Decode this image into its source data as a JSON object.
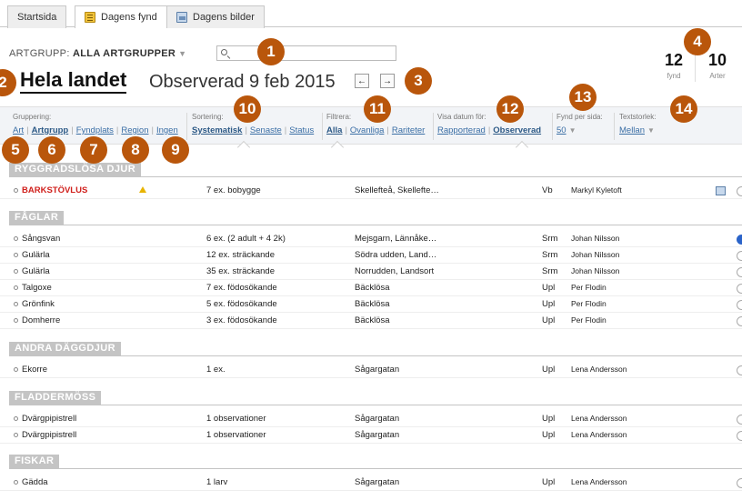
{
  "tabs": [
    {
      "label": "Startsida"
    },
    {
      "label": "Dagens fynd"
    },
    {
      "label": "Dagens bilder"
    }
  ],
  "header": {
    "artgrupp_prefix": "ARTGRUPP:",
    "artgrupp_value": "ALLA ARTGRUPPER",
    "title": "Hela landet",
    "subtitle": "Observerad 9 feb 2015",
    "prev_icon": "arrow-left-icon",
    "next_icon": "arrow-right-icon",
    "stats": [
      {
        "value": "12",
        "label": "fynd"
      },
      {
        "value": "10",
        "label": "Arter"
      }
    ]
  },
  "search": {
    "value": "",
    "placeholder": ""
  },
  "filters": {
    "gruppering": {
      "label": "Gruppering:",
      "options": [
        "Art",
        "Artgrupp",
        "Fyndplats",
        "Region",
        "Ingen"
      ],
      "selected": "Artgrupp"
    },
    "sortering": {
      "label": "Sortering:",
      "options": [
        "Systematisk",
        "Senaste",
        "Status"
      ],
      "selected": "Systematisk"
    },
    "filtrera": {
      "label": "Filtrera:",
      "options": [
        "Alla",
        "Ovanliga",
        "Rariteter"
      ],
      "selected": "Alla"
    },
    "visa_datum": {
      "label": "Visa datum för:",
      "options": [
        "Rapporterad",
        "Observerad"
      ],
      "selected": "Observerad"
    },
    "fynd_per_sida": {
      "label": "Fynd per sida:",
      "value": "50"
    },
    "textstorlek": {
      "label": "Textstorlek:",
      "value": "Mellan"
    }
  },
  "badges": [
    "1",
    "2",
    "3",
    "4",
    "5",
    "6",
    "7",
    "8",
    "9",
    "10",
    "11",
    "12",
    "13",
    "14"
  ],
  "sections": [
    {
      "title": "RYGGRADSLÖSA DJUR",
      "rows": [
        {
          "species": "BARKSTÖVLUS",
          "rare": true,
          "count": "7 ex. bobygge",
          "place": "Skellefteå, Skellefte…",
          "region": "Vb",
          "observer": "Markyl Kyletoft",
          "has_image": true,
          "status": "empty"
        }
      ]
    },
    {
      "title": "FÅGLAR",
      "rows": [
        {
          "species": "Sångsvan",
          "count": "6 ex. (2 adult + 4 2k)",
          "place": "Mejsgarn, Lännåke…",
          "region": "Srm",
          "observer": "Johan Nilsson",
          "status": "filled"
        },
        {
          "species": "Gulärla",
          "count": "12 ex. sträckande",
          "place": "Södra udden, Land…",
          "region": "Srm",
          "observer": "Johan Nilsson",
          "status": "empty"
        },
        {
          "species": "Gulärla",
          "count": "35 ex. sträckande",
          "place": "Norrudden, Landsort",
          "region": "Srm",
          "observer": "Johan Nilsson",
          "status": "empty"
        },
        {
          "species": "Talgoxe",
          "count": "7 ex. födosökande",
          "place": "Bäcklösa",
          "region": "Upl",
          "observer": "Per Flodin",
          "status": "empty"
        },
        {
          "species": "Grönfink",
          "count": "5 ex. födosökande",
          "place": "Bäcklösa",
          "region": "Upl",
          "observer": "Per Flodin",
          "status": "empty"
        },
        {
          "species": "Domherre",
          "count": "3 ex. födosökande",
          "place": "Bäcklösa",
          "region": "Upl",
          "observer": "Per Flodin",
          "status": "empty"
        }
      ]
    },
    {
      "title": "ANDRA DÄGGDJUR",
      "rows": [
        {
          "species": "Ekorre",
          "count": "1 ex.",
          "place": "Sågargatan",
          "region": "Upl",
          "observer": "Lena Andersson",
          "status": "empty"
        }
      ]
    },
    {
      "title": "FLADDERMÖSS",
      "rows": [
        {
          "species": "Dvärgpipistrell",
          "count": "1 observationer",
          "place": "Sågargatan",
          "region": "Upl",
          "observer": "Lena Andersson",
          "status": "empty"
        },
        {
          "species": "Dvärgpipistrell",
          "count": "1 observationer",
          "place": "Sågargatan",
          "region": "Upl",
          "observer": "Lena Andersson",
          "status": "empty"
        }
      ]
    },
    {
      "title": "FISKAR",
      "rows": [
        {
          "species": "Gädda",
          "count": "1 larv",
          "place": "Sågargatan",
          "region": "Upl",
          "observer": "Lena Andersson",
          "status": "empty"
        }
      ]
    }
  ],
  "colors": {
    "badge": "#b9560b",
    "link": "#3a6ea5",
    "rare": "#d0201c",
    "section": "#c4c4c4"
  }
}
